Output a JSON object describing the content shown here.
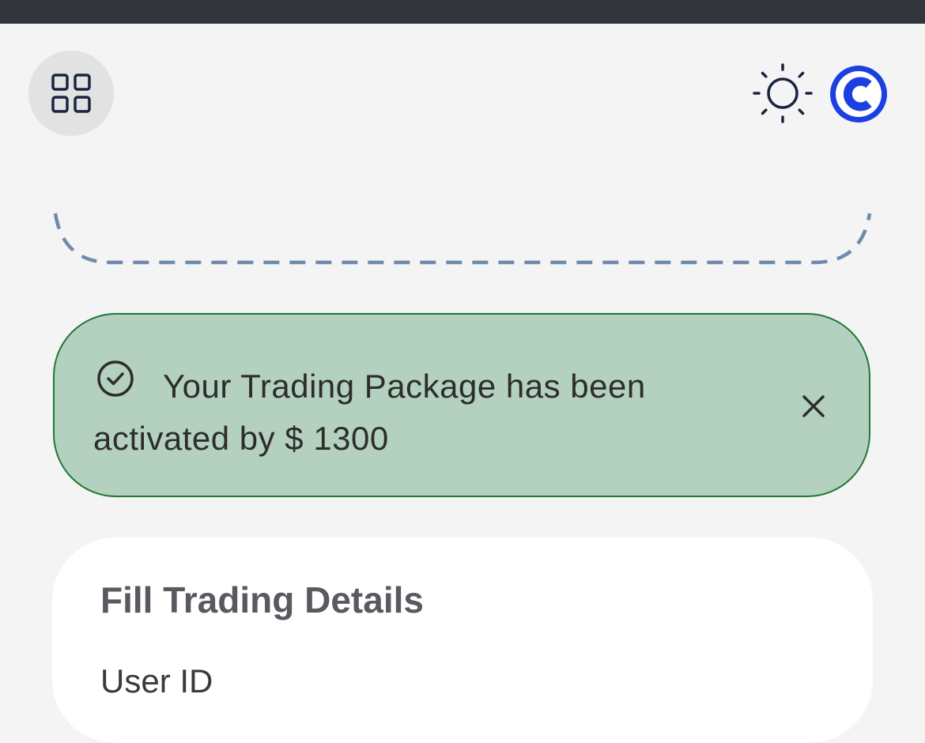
{
  "header": {
    "menu_icon": "grid-icon",
    "theme_icon": "sun-icon",
    "logo_icon": "c-logo",
    "logo_color": "#1c3fe0"
  },
  "alert": {
    "icon": "check-circle-icon",
    "message": "Your Trading Package has been activated by $ 1300",
    "close_icon": "close-icon",
    "background": "#b4d1bf",
    "border": "#1f7a35"
  },
  "form": {
    "title": "Fill Trading Details",
    "fields": [
      {
        "label": "User ID"
      }
    ]
  }
}
